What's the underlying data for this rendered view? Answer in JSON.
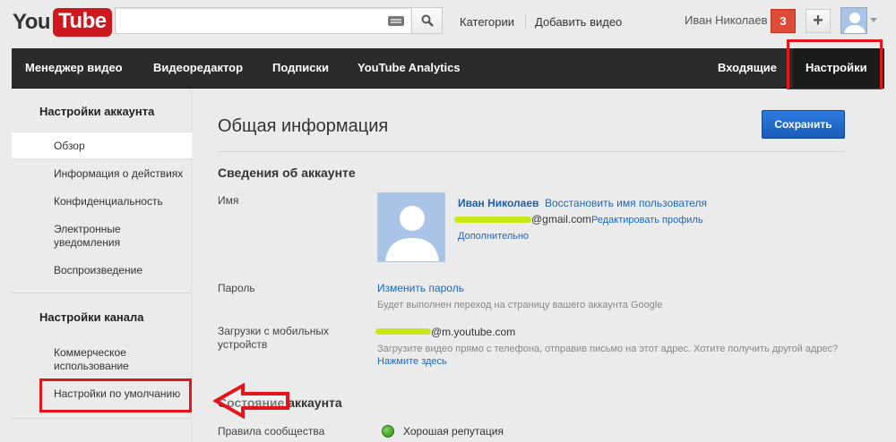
{
  "brand": {
    "you": "You",
    "tube": "Tube"
  },
  "header": {
    "search_placeholder": "",
    "categories": "Категории",
    "add_video": "Добавить видео",
    "user_name": "Иван Николаев",
    "notifications": "3",
    "plus": "+"
  },
  "nav": {
    "items": [
      "Менеджер видео",
      "Видеоредактор",
      "Подписки",
      "YouTube Analytics"
    ],
    "inbox": "Входящие",
    "settings": "Настройки"
  },
  "sidebar": {
    "account_head": "Настройки аккаунта",
    "account_items": [
      "Обзор",
      "Информация о действиях",
      "Конфиденциальность",
      "Электронные уведомления",
      "Воспроизведение"
    ],
    "channel_head": "Настройки канала",
    "channel_items": [
      "Коммерческое использование",
      "Настройки по умолчанию"
    ]
  },
  "main": {
    "title": "Общая информация",
    "save": "Сохранить",
    "account_section": "Сведения об аккаунте",
    "name_label": "Имя",
    "display_name": "Иван Николаев",
    "restore_name": "Восстановить имя пользователя",
    "email_suffix": "@gmail.com",
    "edit_profile": "Редактировать профиль",
    "more": "Дополнительно",
    "password_label": "Пароль",
    "change_password": "Изменить пароль",
    "password_note": "Будет выполнен переход на страницу вашего аккаунта Google",
    "mobile_label": "Загрузки с мобильных устройств",
    "mobile_suffix": "@m.youtube.com",
    "mobile_note": "Загрузите видео прямо с телефона, отправив письмо на этот адрес. Хотите получить другой адрес?",
    "click_here": "Нажмите здесь",
    "status_section": "Состояние аккаунта",
    "community_label": "Правила сообщества",
    "reputation": "Хорошая репутация"
  },
  "colors": {
    "accent": "#e8141b",
    "link": "#1b67c2",
    "nav_bg": "#2b2b2b",
    "save_btn": "#1a5cb8",
    "redaction": "#c7e800"
  }
}
